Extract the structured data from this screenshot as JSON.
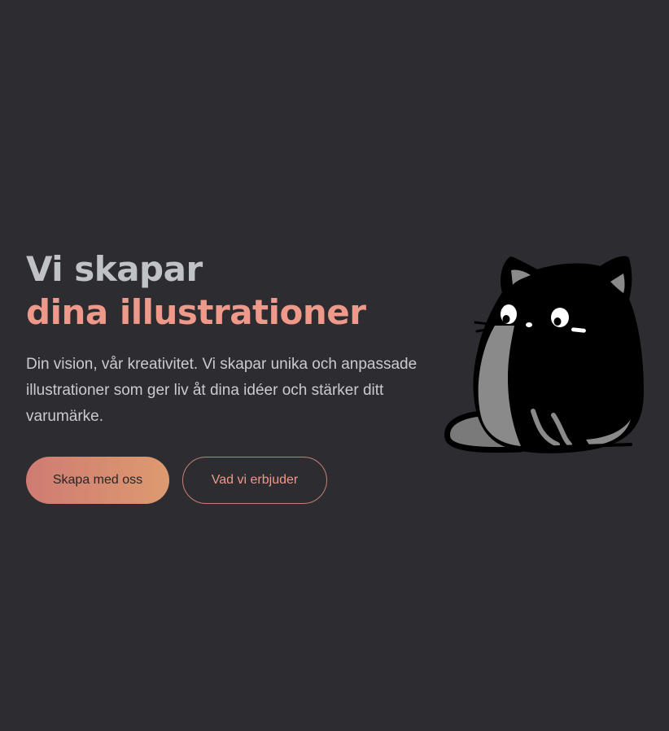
{
  "hero": {
    "headline_line1": "Vi skapar",
    "headline_line2": "dina illustrationer",
    "lead": "Din vision, vår kreativitet. Vi skapar unika och anpassade illustrationer som ger liv åt dina idéer och stärker ditt varumärke."
  },
  "actions": {
    "primary_label": "Skapa med oss",
    "secondary_label": "Vad vi erbjuder"
  },
  "illustration": {
    "icon": "black-cat-illustration"
  },
  "colors": {
    "background": "#2d2c31",
    "headline_gray": "#bfc3c8",
    "accent_salmon": "#ef998a",
    "gradient_start": "#cf7b72",
    "gradient_end": "#dd9a70"
  }
}
